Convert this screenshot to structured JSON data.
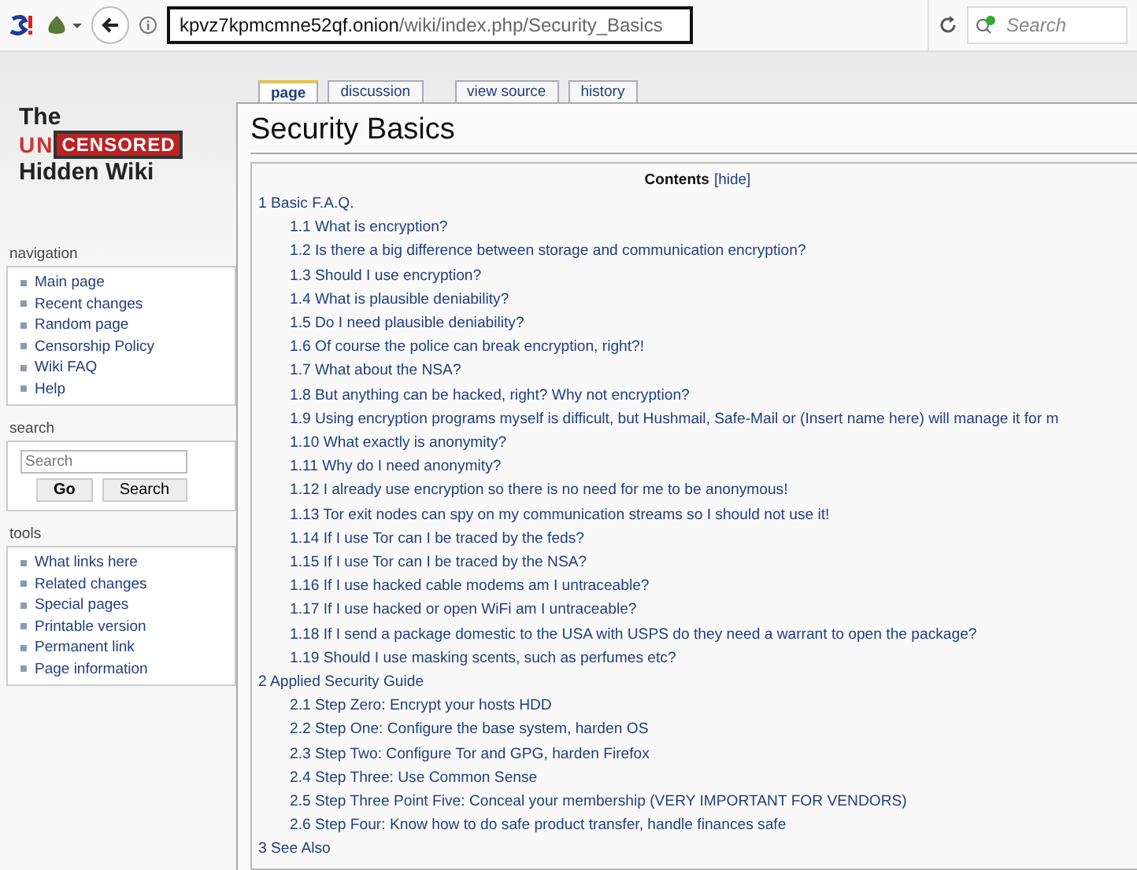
{
  "browser": {
    "url_host": "kpvz7kpmcmne52qf.onion",
    "url_path": "/wiki/index.php/Security_Basics",
    "search_placeholder": "Search"
  },
  "logo": {
    "line_1": "The",
    "line_2a": "UN",
    "line_2b": "CENSORED",
    "line_3": "Hidden Wiki"
  },
  "sidebar": {
    "navigation": {
      "title": "navigation",
      "items": [
        "Main page",
        "Recent changes",
        "Random page",
        "Censorship Policy",
        "Wiki FAQ",
        "Help"
      ]
    },
    "search": {
      "title": "search",
      "placeholder": "Search",
      "buttons": [
        "Go",
        "Search"
      ]
    },
    "tools": {
      "title": "tools",
      "items": [
        "What links here",
        "Related changes",
        "Special pages",
        "Printable version",
        "Permanent link",
        "Page information"
      ]
    }
  },
  "tabs": [
    {
      "label": "page",
      "selected": true
    },
    {
      "label": "discussion",
      "selected": false
    },
    {
      "label": "view source",
      "selected": false
    },
    {
      "label": "history",
      "selected": false
    }
  ],
  "page_title": "Security Basics",
  "toc": {
    "title": "Contents",
    "toggle": "[hide]",
    "items": [
      {
        "text": "1 Basic F.A.Q.",
        "children": [
          {
            "text": "1.1 What is encryption?"
          },
          {
            "text": "1.2 Is there a big difference between storage and communication encryption?"
          },
          {
            "text": "1.3 Should I use encryption?"
          },
          {
            "text": "1.4 What is plausible deniability?"
          },
          {
            "text": "1.5 Do I need plausible deniability?"
          },
          {
            "text": "1.6 Of course the police can break encryption, right?!"
          },
          {
            "text": "1.7 What about the NSA?"
          },
          {
            "text": "1.8 But anything can be hacked, right? Why not encryption?"
          },
          {
            "text": "1.9 Using encryption programs myself is difficult, but Hushmail, Safe-Mail or (Insert name here) will manage it for m"
          },
          {
            "text": "1.10 What exactly is anonymity?"
          },
          {
            "text": "1.11 Why do I need anonymity?"
          },
          {
            "text": "1.12 I already use encryption so there is no need for me to be anonymous!"
          },
          {
            "text": "1.13 Tor exit nodes can spy on my communication streams so I should not use it!"
          },
          {
            "text": "1.14 If I use Tor can I be traced by the feds?"
          },
          {
            "text": "1.15 If I use Tor can I be traced by the NSA?"
          },
          {
            "text": "1.16 If I use hacked cable modems am I untraceable?"
          },
          {
            "text": "1.17 If I use hacked or open WiFi am I untraceable?"
          },
          {
            "text": "1.18 If I send a package domestic to the USA with USPS do they need a warrant to open the package?"
          },
          {
            "text": "1.19 Should I use masking scents, such as perfumes etc?"
          }
        ]
      },
      {
        "text": "2 Applied Security Guide",
        "children": [
          {
            "text": "2.1 Step Zero: Encrypt your hosts HDD"
          },
          {
            "text": "2.2 Step One: Configure the base system, harden OS"
          },
          {
            "text": "2.3 Step Two: Configure Tor and GPG, harden Firefox"
          },
          {
            "text": "2.4 Step Three: Use Common Sense"
          },
          {
            "text": "2.5 Step Three Point Five: Conceal your membership (VERY IMPORTANT FOR VENDORS)"
          },
          {
            "text": "2.6 Step Four: Know how to do safe product transfer, handle finances safe"
          }
        ]
      },
      {
        "text": "3 See Also"
      }
    ]
  }
}
